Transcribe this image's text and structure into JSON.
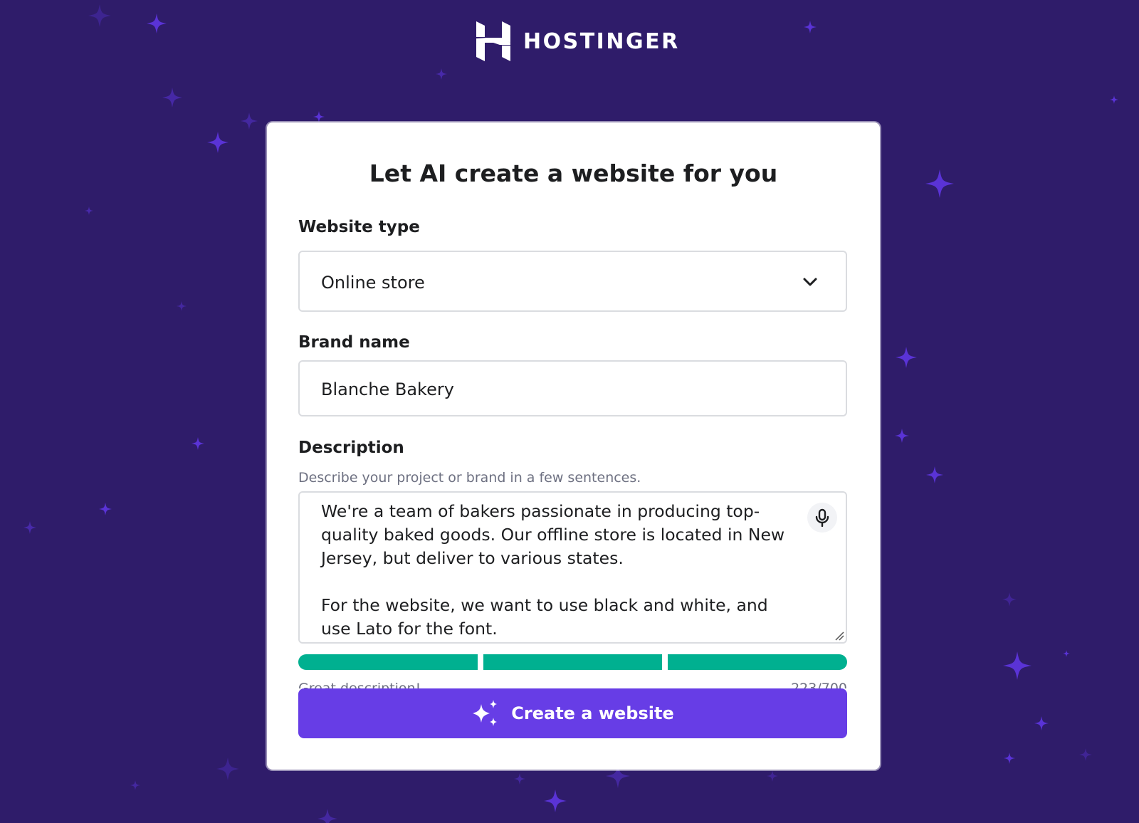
{
  "brand": {
    "name": "HOSTINGER",
    "icon": "hostinger-h-logo"
  },
  "colors": {
    "background": "#2f1c6a",
    "star": "#5a33d6",
    "primary_button": "#673de6",
    "progress": "#00b090",
    "text": "#1d1e20",
    "muted_text": "#6d7081"
  },
  "form": {
    "title": "Let AI create a website for you",
    "website_type": {
      "label": "Website type",
      "value": "Online store",
      "icon": "chevron-down-icon"
    },
    "brand_name": {
      "label": "Brand name",
      "value": "Blanche Bakery"
    },
    "description": {
      "label": "Description",
      "hint": "Describe your project or brand in a few sentences.",
      "value": "We're a team of bakers passionate in producing top-quality baked goods. Our offline store is located in New Jersey, but deliver to various states.\n\nFor the website, we want to use black and white, and use Lato for the font.",
      "icon": "microphone-icon",
      "quality_segments": 3,
      "feedback": "Great description!",
      "counter": "223/700"
    },
    "submit": {
      "label": "Create a website",
      "icon": "sparkles-icon"
    }
  }
}
